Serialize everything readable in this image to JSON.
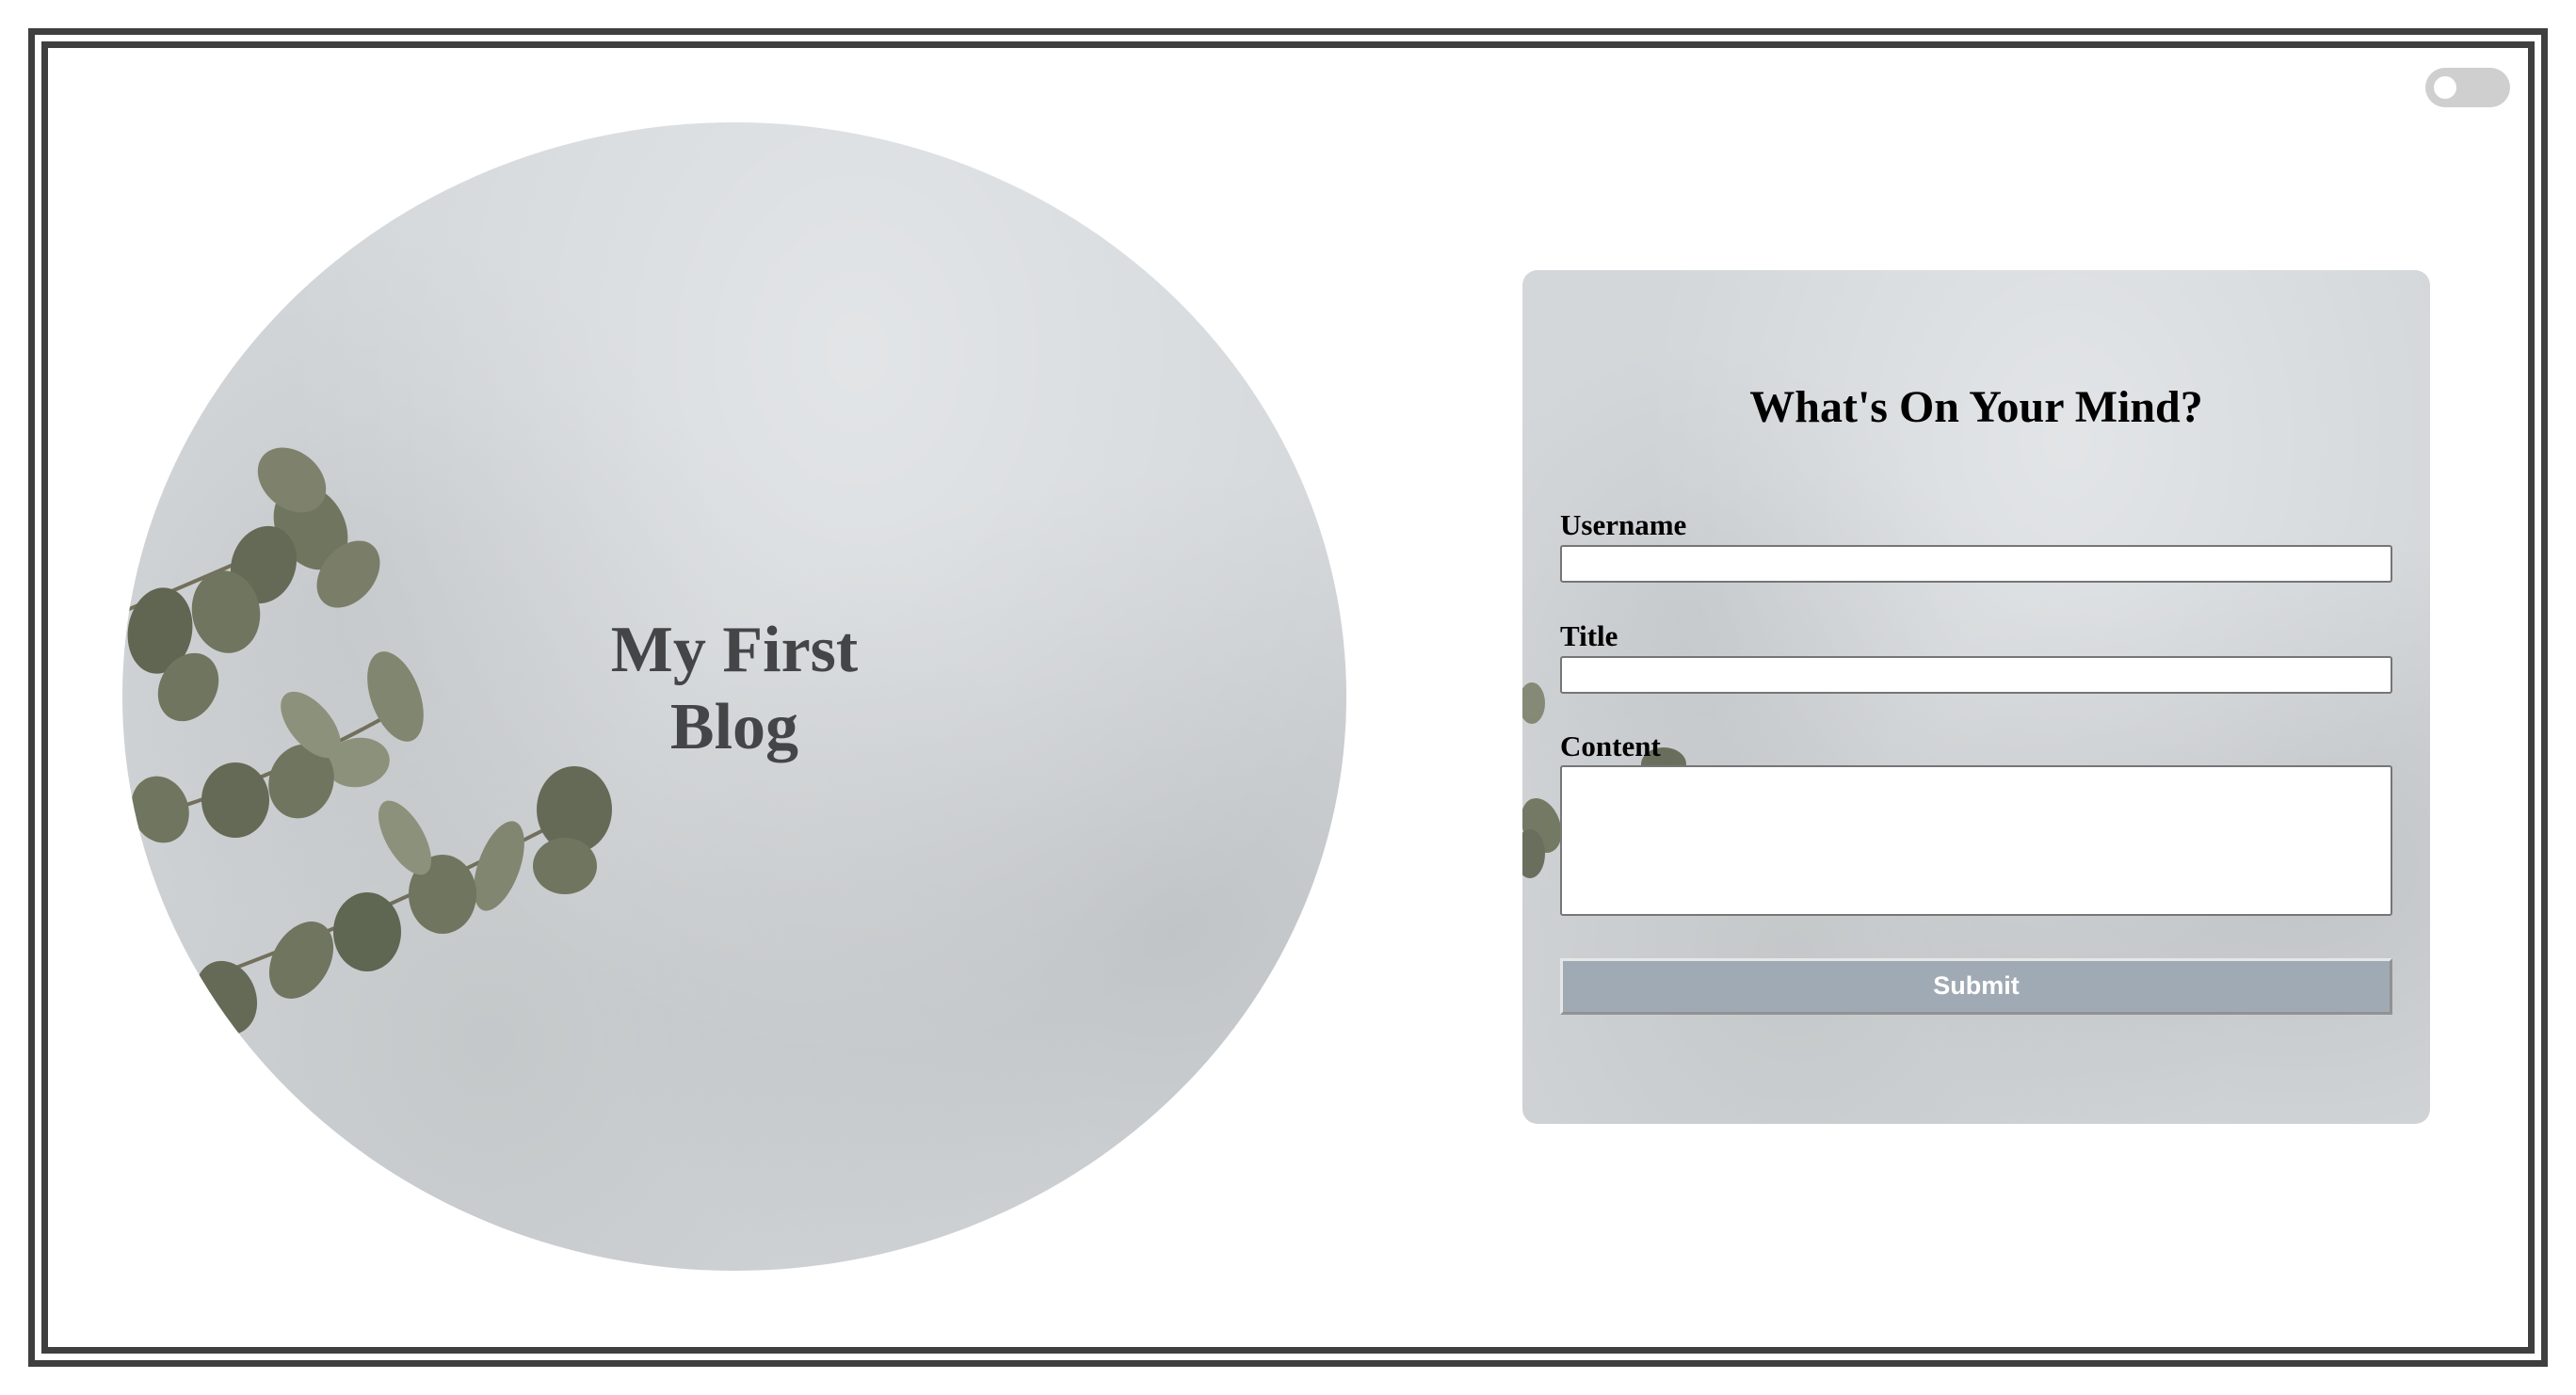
{
  "theme_toggle": {
    "state": "off",
    "track_color": "#cfcfcf",
    "knob_color": "#ffffff"
  },
  "hero": {
    "title": "My First Blog",
    "background": "concrete-with-eucalyptus"
  },
  "form": {
    "heading": "What's On Your Mind?",
    "username_label": "Username",
    "username_value": "",
    "title_label": "Title",
    "title_value": "",
    "content_label": "Content",
    "content_value": "",
    "submit_label": "Submit",
    "submit_color": "#a0aab4"
  },
  "colors": {
    "frame": "#3f3f3f",
    "text_dark": "#444546",
    "leaf": "#6b7059"
  }
}
